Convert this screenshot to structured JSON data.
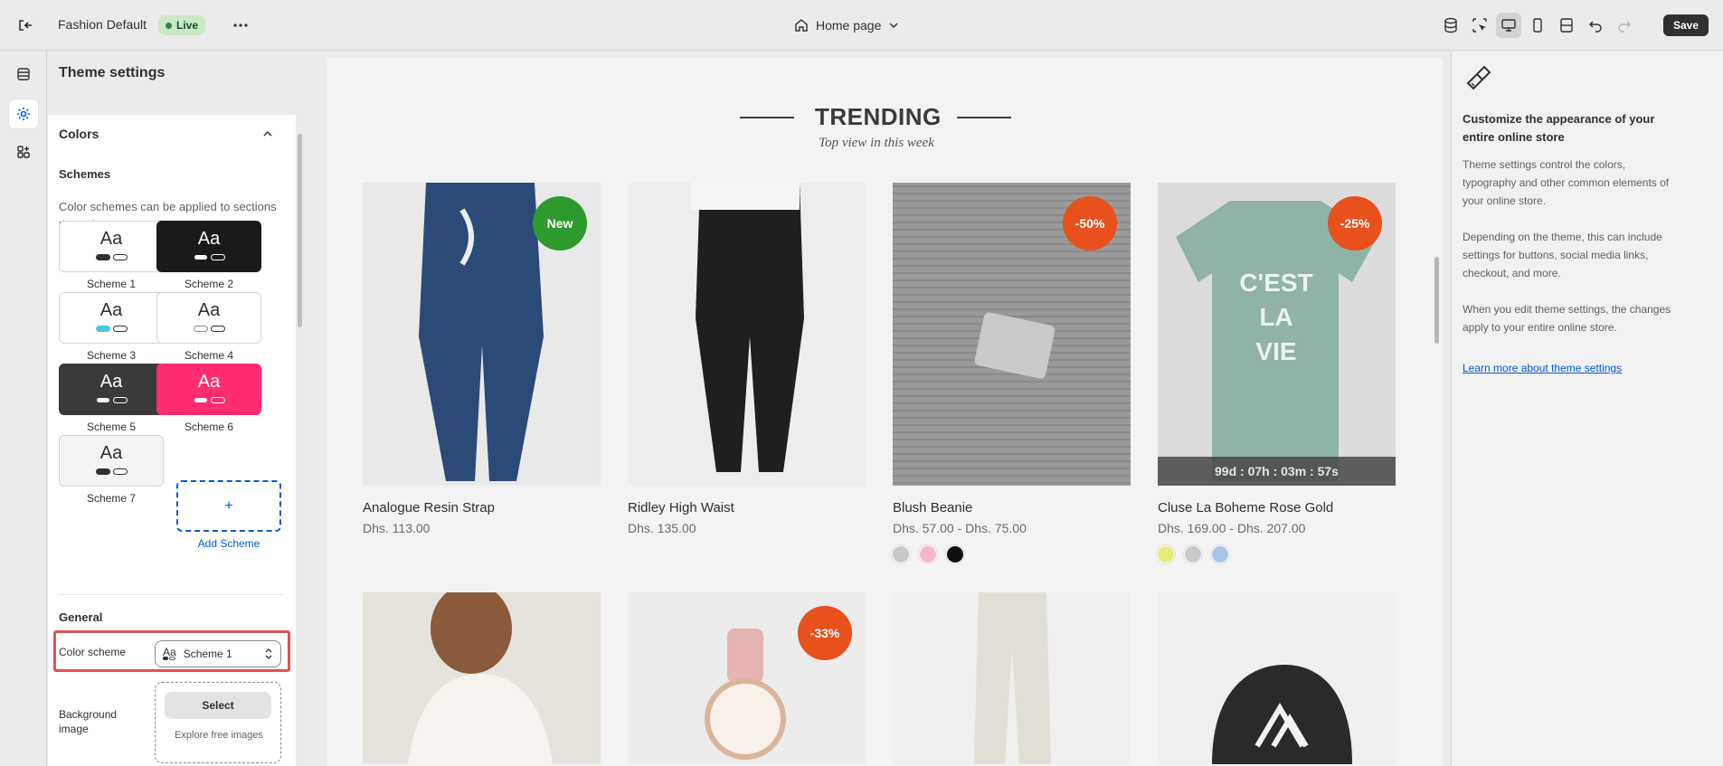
{
  "topbar": {
    "theme_name": "Fashion Default",
    "live_label": "Live",
    "page_label": "Home page",
    "save_label": "Save"
  },
  "settings": {
    "title": "Theme settings",
    "section_title": "Colors",
    "schemes_heading": "Schemes",
    "schemes_description": "Color schemes can be applied to sections throughout your online store.",
    "swatch_text": "Aa",
    "schemes": [
      {
        "label": "Scheme 1",
        "bg": "#ffffff",
        "fg": "#303030",
        "pill1": "#303030",
        "pill2": "#ffffff"
      },
      {
        "label": "Scheme 2",
        "bg": "#1a1a1a",
        "fg": "#ffffff",
        "pill1": "#ffffff",
        "pill2": "#1a1a1a"
      },
      {
        "label": "Scheme 3",
        "bg": "#ffffff",
        "fg": "#303030",
        "pill1": "#4cc9e0",
        "pill2": "#ffffff"
      },
      {
        "label": "Scheme 4",
        "bg": "#ffffff",
        "fg": "#303030",
        "pill1": "#ffffff",
        "pill2": "#ffffff"
      },
      {
        "label": "Scheme 5",
        "bg": "#3a3a3a",
        "fg": "#ffffff",
        "pill1": "#ffffff",
        "pill2": "#3a3a3a"
      },
      {
        "label": "Scheme 6",
        "bg": "#ff2d6f",
        "fg": "#ffffff",
        "pill1": "#ffffff",
        "pill2": "#ff2d6f"
      },
      {
        "label": "Scheme 7",
        "bg": "#f4f4f4",
        "fg": "#303030",
        "pill1": "#303030",
        "pill2": "#ffffff"
      }
    ],
    "add_scheme_label": "Add Scheme",
    "add_scheme_icon": "+",
    "general_heading": "General",
    "color_scheme_label": "Color scheme",
    "color_scheme_value": "Scheme 1",
    "background_image_label": "Background image",
    "select_label": "Select",
    "explore_label": "Explore free images",
    "highlight_color": "#e05252"
  },
  "preview": {
    "section_title": "TRENDING",
    "section_subtitle": "Top view in this week",
    "products": [
      {
        "name": "Analogue Resin Strap",
        "price": "Dhs. 113.00",
        "badge": "New",
        "badge_color": "#2e9a2e",
        "img": "#2c4a78"
      },
      {
        "name": "Ridley High Waist",
        "price": "Dhs. 135.00",
        "badge": "",
        "badge_color": "",
        "img": "#1f1f1f"
      },
      {
        "name": "Blush Beanie",
        "price": "Dhs. 57.00 - Dhs. 75.00",
        "badge": "-50%",
        "badge_color": "#e8501c",
        "img": "#9a9a9a"
      },
      {
        "name": "Cluse La Boheme Rose Gold",
        "price": "Dhs. 169.00 - Dhs. 207.00",
        "badge": "-25%",
        "badge_color": "#e8501c",
        "img": "#8fb3a6"
      }
    ],
    "timer": "99d : 07h : 03m : 57s",
    "beanie_colors": [
      "#c8c8c8",
      "#f4b6c8",
      "#111111"
    ],
    "tee_colors": [
      "#e6ec7a",
      "#c9c9c9",
      "#a9c4e6"
    ],
    "row2_badge": "-33%",
    "tee_text": "C'EST LA VIE"
  },
  "help": {
    "title": "Customize the appearance of your entire online store",
    "p1": "Theme settings control the colors, typography and other common elements of your online store.",
    "p2": "Depending on the theme, this can include settings for buttons, social media links, checkout, and more.",
    "p3": "When you edit theme settings, the changes apply to your entire online store.",
    "link": "Learn more about theme settings"
  }
}
